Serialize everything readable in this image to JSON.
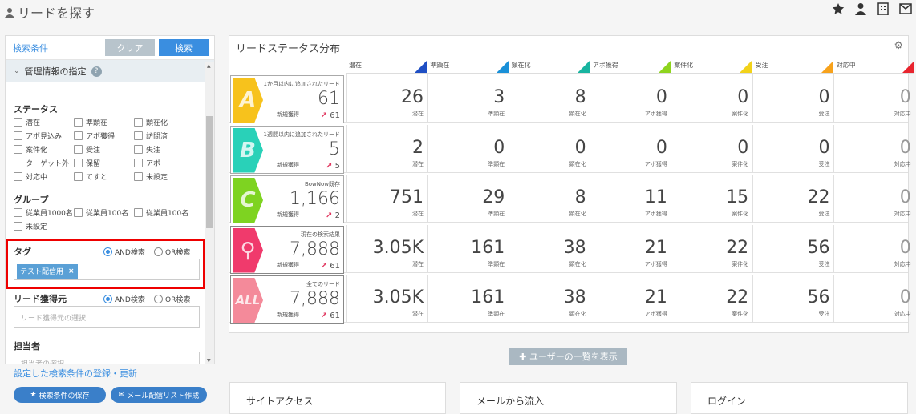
{
  "page": {
    "title": "リードを探す"
  },
  "left": {
    "tab_label": "検索条件",
    "clear_label": "クリア",
    "search_label": "検索",
    "section_title": "管理情報の指定",
    "status_label": "ステータス",
    "status_items": [
      "潜在",
      "準顕在",
      "顕在化",
      "アポ見込み",
      "アポ獲得",
      "訪問済",
      "案件化",
      "受注",
      "失注",
      "ターゲット外",
      "保留",
      "アポ",
      "対応中",
      "てすと",
      "未設定"
    ],
    "group_label": "グループ",
    "group_items": [
      "従業員1000名",
      "従業員100名",
      "従業員100名",
      "未設定"
    ],
    "tag_label": "タグ",
    "and_label": "AND検索",
    "or_label": "OR検索",
    "tag_chip": "テスト配信用",
    "source_label": "リード獲得元",
    "source_placeholder": "リード獲得元の選択",
    "owner_label": "担当者",
    "owner_placeholder": "担当者の選択",
    "save_link": "設定した検索条件の登録・更新",
    "save_btn": "検索条件の保存",
    "mail_btn": "メール配信リスト作成"
  },
  "right": {
    "title": "リードステータス分布",
    "columns": [
      {
        "name": "潜在",
        "color": "#1f4fc4"
      },
      {
        "name": "準顕在",
        "color": "#1990d8"
      },
      {
        "name": "顕在化",
        "color": "#18b4a0"
      },
      {
        "name": "アポ獲得",
        "color": "#8ed41e"
      },
      {
        "name": "案件化",
        "color": "#f2d21a"
      },
      {
        "name": "受注",
        "color": "#f7a21c"
      },
      {
        "name": "対応中",
        "color": "#e8242e"
      }
    ],
    "rows": [
      {
        "badge": "A",
        "badge_color": "#f7c21c",
        "name": "1か月以内に追加されたリード",
        "total": "61",
        "new_label": "新規獲得",
        "delta": "61",
        "values": [
          "26",
          "3",
          "8",
          "0",
          "0",
          "0",
          "0"
        ],
        "gray_last": true
      },
      {
        "badge": "B",
        "badge_color": "#29d1b8",
        "name": "1週間以内に追加されたリード",
        "total": "5",
        "new_label": "新規獲得",
        "delta": "5",
        "values": [
          "2",
          "0",
          "0",
          "0",
          "0",
          "0",
          "0"
        ],
        "gray_last": true
      },
      {
        "badge": "C",
        "badge_color": "#7ed321",
        "name": "BowNow既存",
        "total": "1,166",
        "new_label": "新規獲得",
        "delta": "2",
        "values": [
          "751",
          "29",
          "8",
          "11",
          "15",
          "22",
          "0"
        ],
        "gray_last": true
      },
      {
        "badge": "⚲",
        "badge_color": "#f03a6c",
        "name": "現在の検索結果",
        "total": "7,888",
        "new_label": "新規獲得",
        "delta": "61",
        "values": [
          "3.05K",
          "161",
          "38",
          "21",
          "22",
          "56",
          "0"
        ],
        "gray_last": true
      },
      {
        "badge": "ALL",
        "badge_color": "#f48a9a",
        "name": "全てのリード",
        "total": "7,888",
        "new_label": "新規獲得",
        "delta": "61",
        "values": [
          "3.05K",
          "161",
          "38",
          "21",
          "22",
          "56",
          "0"
        ],
        "gray_last": true
      }
    ],
    "show_users_btn": "ユーザーの一覧を表示",
    "cards": [
      "サイトアクセス",
      "メールから流入",
      "ログイン"
    ]
  }
}
